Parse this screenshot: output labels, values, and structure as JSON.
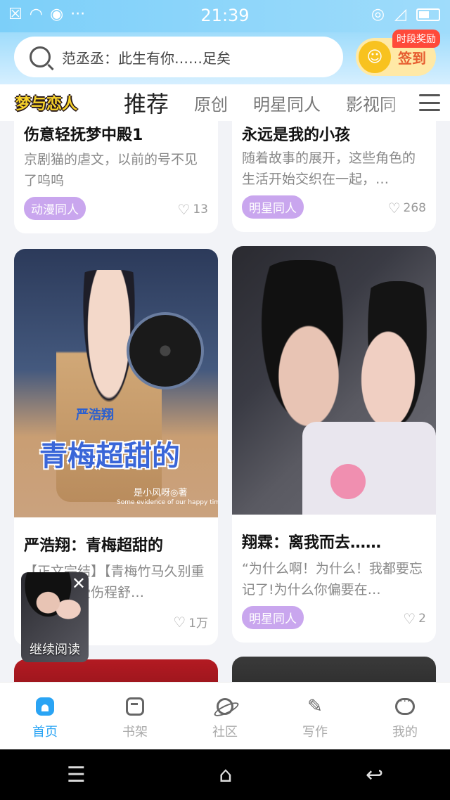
{
  "status_bar": {
    "time": "21:39"
  },
  "search": {
    "placeholder": "范丞丞：此生有你……足矣"
  },
  "signin": {
    "label": "签到",
    "badge": "时段奖励"
  },
  "tabs": {
    "logo": "梦与恋人",
    "items": [
      "推荐",
      "原创",
      "明星同人",
      "影视同"
    ]
  },
  "cards": [
    {
      "title": "伤意轻抚梦中殿1",
      "summary": "京剧猫的虐文，以前的号不见了呜呜",
      "tag": "动漫同人",
      "likes": "13"
    },
    {
      "title": "永远是我的小孩",
      "summary": "随着故事的展开，这些角色的生活开始交织在一起，…",
      "tag": "明星同人",
      "likes": "268"
    },
    {
      "title": "严浩翔：青梅超甜的",
      "summary": "【正文完结】【青梅竹马久别重逢因同事受伤程舒…",
      "likes": "1万",
      "cover": {
        "name": "严浩翔",
        "main": "青梅超甜的",
        "author": "是小风呀◎著",
        "sub": "Some evidence of our happy time."
      }
    },
    {
      "title": "翔霖：离我而去……",
      "summary": "“为什么啊！为什么！我都要忘记了!为什么你偏要在…",
      "tag": "明星同人",
      "likes": "2"
    }
  ],
  "continue_reading": {
    "label": "继续阅读"
  },
  "bottom_nav": {
    "items": [
      {
        "label": "首页",
        "icon": "home-icon",
        "active": true
      },
      {
        "label": "书架",
        "icon": "bookshelf-icon",
        "active": false
      },
      {
        "label": "社区",
        "icon": "planet-icon",
        "active": false
      },
      {
        "label": "写作",
        "icon": "pen-icon",
        "active": false
      },
      {
        "label": "我的",
        "icon": "message-icon",
        "active": false
      }
    ]
  },
  "colors": {
    "accent": "#2aa4f4",
    "tag": "#c9a6ee",
    "badge": "#ff4a3a"
  }
}
